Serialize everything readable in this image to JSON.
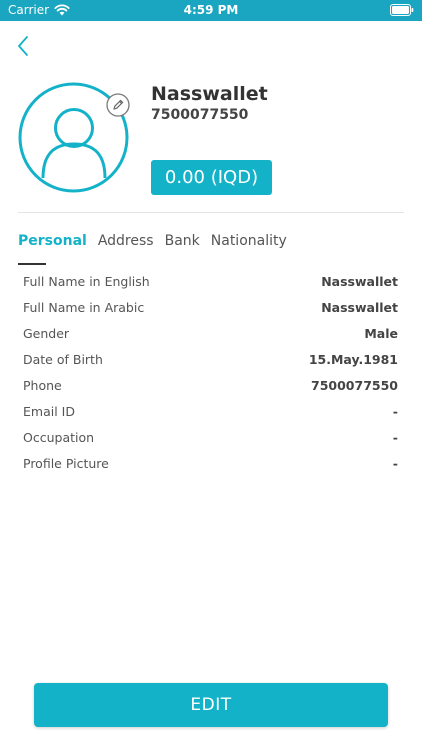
{
  "status_bar": {
    "carrier": "Carrier",
    "time": "4:59 PM"
  },
  "profile": {
    "name": "Nasswallet",
    "phone": "7500077550",
    "balance": "0.00 (IQD)"
  },
  "tabs": [
    {
      "label": "Personal",
      "active": true
    },
    {
      "label": "Address",
      "active": false
    },
    {
      "label": "Bank",
      "active": false
    },
    {
      "label": "Nationality",
      "active": false
    }
  ],
  "details": [
    {
      "label": "Full Name in English",
      "value": "Nasswallet"
    },
    {
      "label": "Full Name in Arabic",
      "value": "Nasswallet"
    },
    {
      "label": "Gender",
      "value": "Male"
    },
    {
      "label": "Date of Birth",
      "value": "15.May.1981"
    },
    {
      "label": "Phone",
      "value": "7500077550"
    },
    {
      "label": "Email ID",
      "value": "-"
    },
    {
      "label": "Occupation",
      "value": "-"
    },
    {
      "label": "Profile Picture",
      "value": "-"
    }
  ],
  "actions": {
    "edit_label": "EDIT"
  },
  "icons": {
    "back": "chevron-left-icon",
    "avatar": "user-avatar-icon",
    "avatar_edit": "pencil-icon",
    "wifi": "wifi-icon",
    "battery": "battery-icon"
  },
  "colors": {
    "accent": "#14b2c9",
    "status_bar": "#1aa6c1",
    "text": "#333333",
    "divider": "#e4e4e4"
  }
}
